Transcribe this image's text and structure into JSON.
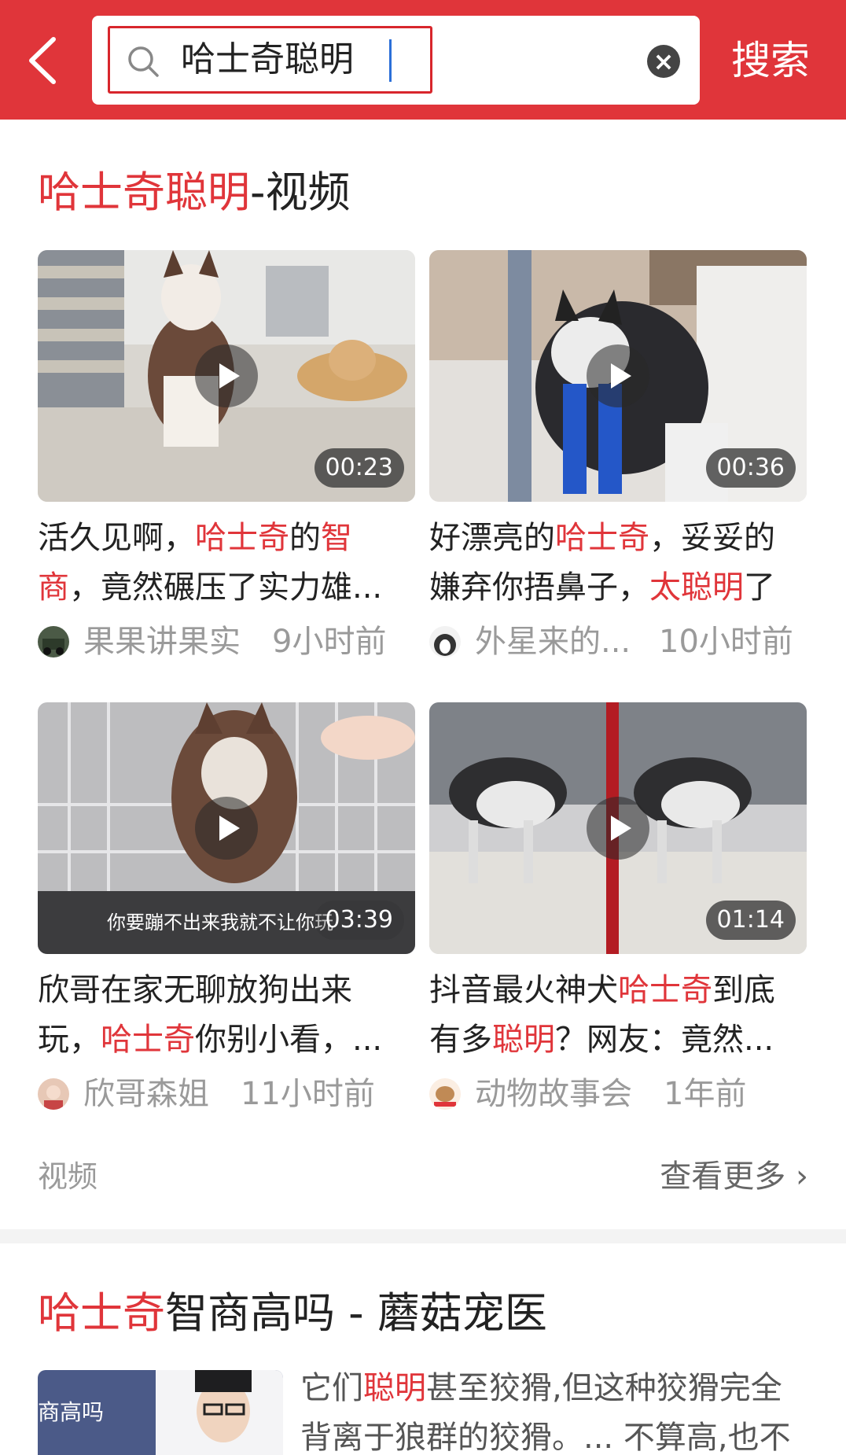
{
  "search": {
    "query": "哈士奇聪明",
    "clear_symbol": "×",
    "submit_label": "搜索"
  },
  "section": {
    "title_highlight": "哈士奇聪明",
    "title_suffix": "-视频"
  },
  "videos": [
    {
      "duration": "00:23",
      "caption_line1": [
        "活久见啊，",
        "哈士奇",
        "的",
        "智"
      ],
      "caption_line2": [
        "商",
        "，竟然碾压了实力雄..."
      ],
      "author": "果果讲果实",
      "time": "9小时前"
    },
    {
      "duration": "00:36",
      "caption_line1": [
        "好漂亮的",
        "哈士奇",
        "，妥妥的"
      ],
      "caption_line2": [
        "嫌弃你捂鼻子，",
        "太聪明",
        "了"
      ],
      "author": "外星来的...",
      "time": "10小时前"
    },
    {
      "duration": "03:39",
      "overlay_text": "你要蹦不出来我就不让你玩",
      "caption_line1": [
        "欣哥在家无聊放狗出来"
      ],
      "caption_line2": [
        "玩，",
        "哈士奇",
        "你别小看，..."
      ],
      "author": "欣哥森姐",
      "time": "11小时前"
    },
    {
      "duration": "01:14",
      "caption_line1": [
        "抖音最火神犬",
        "哈士奇",
        "到底"
      ],
      "caption_line2": [
        "有多",
        "聪明",
        "？网友：竟然..."
      ],
      "author": "动物故事会",
      "time": "1年前"
    }
  ],
  "footer": {
    "category": "视频",
    "more": "查看更多",
    "more_arrow": "›"
  },
  "article": {
    "title_highlight": "哈士奇",
    "title_rest": "智商高吗 - 蘑菇宠医",
    "thumb_text": "商高吗",
    "line1": [
      "它们",
      "聪明",
      "甚至狡猾,但这种狡猾完全"
    ],
    "line2": [
      "背离于狼群的狡猾。... 不算高,也不"
    ]
  },
  "colors": {
    "brand_red": "#e0353a",
    "highlight": "#e0353a"
  }
}
